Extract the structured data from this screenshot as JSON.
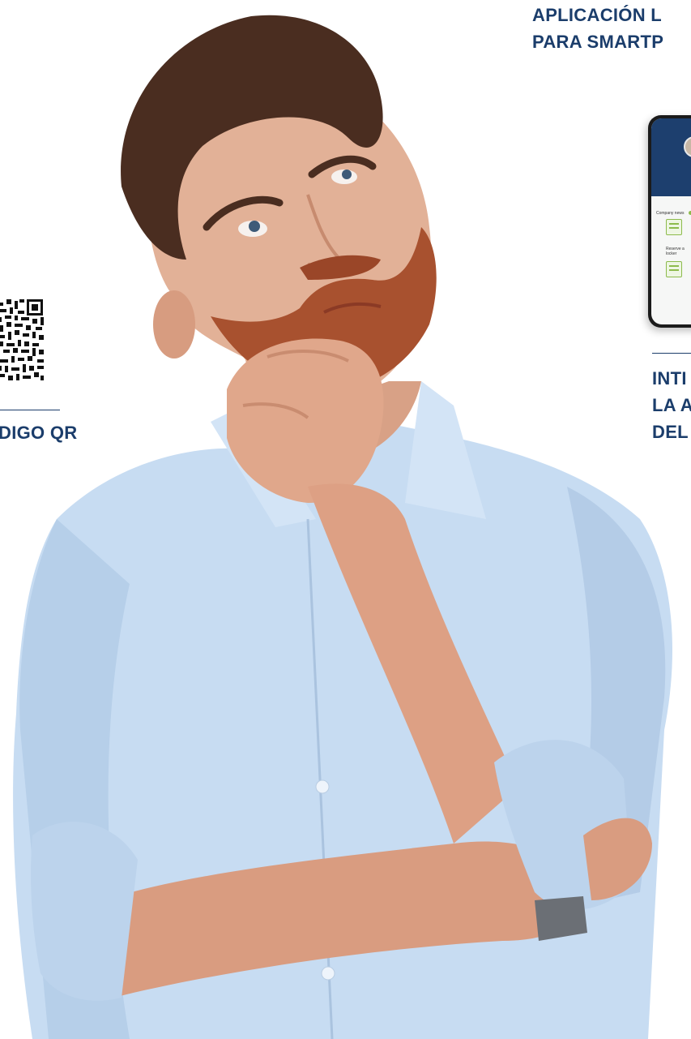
{
  "headings": {
    "top": [
      "APLICACIÓN L",
      "PARA SMARTP"
    ],
    "qr_caption": "DIGO QR",
    "side": [
      "INTI",
      "LA A",
      "DEL"
    ]
  },
  "phone_app": {
    "section_news": "Company news",
    "item_reserve": "Reserve a locker"
  },
  "colors": {
    "heading": "#1b3d6b",
    "shirt": "#c7dcf2",
    "app_header": "#1d3f6e",
    "app_accent": "#8dbb4c"
  }
}
